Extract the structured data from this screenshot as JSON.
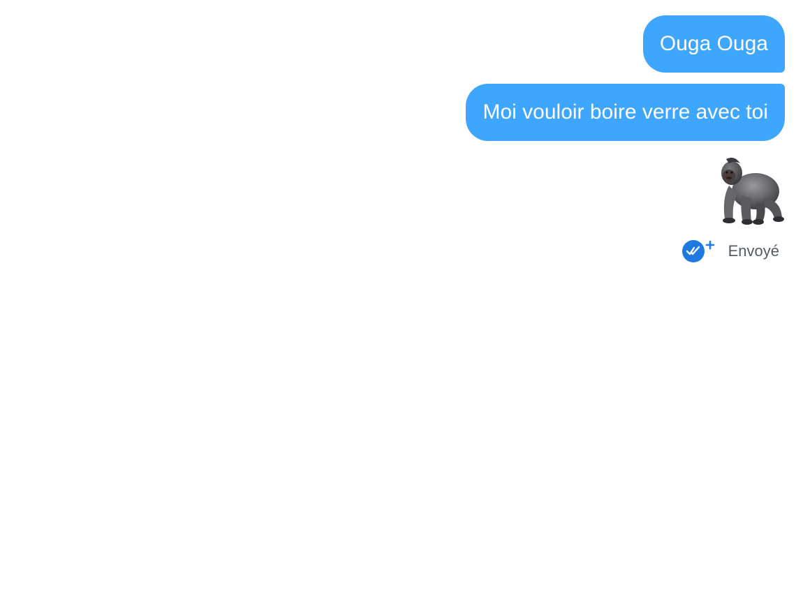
{
  "messages": [
    {
      "text": "Ouga Ouga"
    },
    {
      "text": "Moi vouloir boire verre avec toi"
    },
    {
      "emoji": "gorilla-emoji"
    }
  ],
  "status": {
    "label": "Envoyé",
    "icon": "read-receipt-plus-icon",
    "icon_color": "#1f7ae0"
  },
  "colors": {
    "bubble": "#3ea6ff",
    "bubble_text": "#ffffff",
    "background": "#ffffff"
  }
}
